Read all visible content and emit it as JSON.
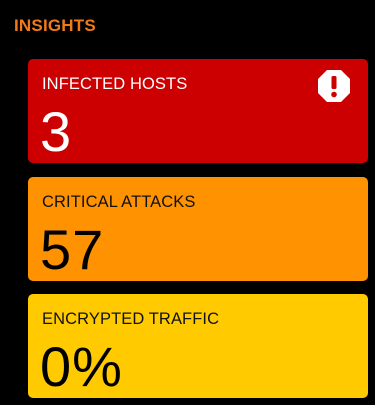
{
  "panel": {
    "title": "INSIGHTS",
    "title_color": "#f07a1a",
    "background": "#000000"
  },
  "cards": [
    {
      "label": "INFECTED HOSTS",
      "value": "3",
      "color": "#cc0000",
      "icon": "alert-octagon-icon"
    },
    {
      "label": "CRITICAL ATTACKS",
      "value": "57",
      "color": "#ff9200"
    },
    {
      "label": "ENCRYPTED TRAFFIC",
      "value": "0%",
      "color": "#ffcb00"
    }
  ]
}
